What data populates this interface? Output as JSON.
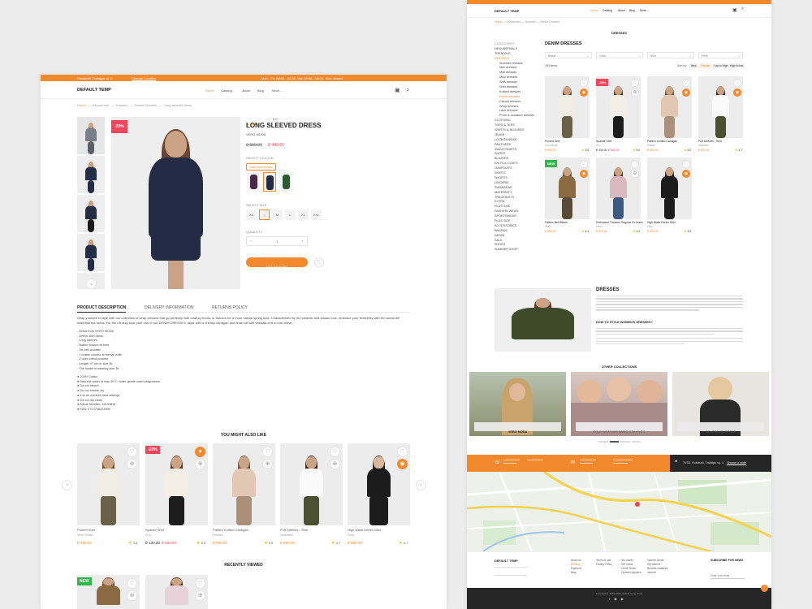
{
  "left": {
    "topbar": {
      "address": "Rustaveli, Trafalgar st. 4",
      "change_location": "Change Location",
      "phone": "Mon - Fri: 08:00 - 22:00",
      "hours": "Sat: 09:00 - 18:00",
      "sun": "Sun: closed"
    },
    "header": {
      "logo": "DEFAULT TEMP",
      "nav": [
        "Home",
        "Catalog",
        "About",
        "Blog",
        "More..."
      ]
    },
    "breadcrumb": [
      "Home",
      "Assortment",
      "Dresses",
      "Denim Dresses",
      "Long sleeved dress"
    ],
    "product": {
      "discount": "-20%",
      "rating": "5.0",
      "title": "LONG SLEEVED DRESS",
      "brand": "VERO MODA",
      "old_price": "₽ 550.00",
      "new_price": "₽ 440.00",
      "colour_label": "SELECT COLOUR",
      "colour_selected": "Dark blue flower",
      "size_label": "SELECT SIZE",
      "sizes": [
        "XS",
        "S",
        "M",
        "L",
        "XL",
        "XXL"
      ],
      "quantity_label": "QUANTITY",
      "quantity": "1",
      "add_to_cart": "ADD TO CART"
    },
    "tabs": [
      "PRODUCT DESCRIPTION",
      "DELIVERY INFORMATION",
      "RETURNS POLICY"
    ],
    "description": "Wrap yourself in style with our collection of wrap dresses that go perfectly with cowboy boots, or trainers for a more casual spring look. Characterised by its romantic and classic look, embrace your femininity with the wardrobe essential tea dress. For the off-duty look, pick one of our DENIM DRESSES, layer with a chunky cardigan and finish off with sandals and a cute clutch.",
    "features_1": [
      "Dress from VERO MODA",
      "Denim shirt dress",
      "Long sleeves",
      "Button closure at front",
      "Tie belt at waist",
      "1 button closure at sleeve cuffs",
      "2 open chest pockets",
      "Length: 97 cm in size 36",
      "The model is wearing size 36"
    ],
    "features_2": [
      "100% Cotton",
      "Machine wash at max 40°C under gentle wash programme",
      "Do not bleach",
      "Do not tumble dry",
      "Iron on medium heat settings",
      "Do not dry clean",
      "Article Number: 15133818",
      "EAN: 5713746323090"
    ],
    "related_title": "YOU MIGHT ALSO LIKE",
    "related": [
      {
        "name": "Printed Shirt",
        "brand": "Vero Moda",
        "price": "₽ 890.00",
        "old": "",
        "rating": "3.5",
        "badge": ""
      },
      {
        "name": "Sparkle Shirt",
        "brand": "G.G.",
        "price": "₽ 430.00",
        "old": "₽ 560.00",
        "rating": "5.0",
        "badge": "-20%"
      },
      {
        "name": "Pattern Knitted Cardigan",
        "brand": "Planes",
        "price": "₽ 890.00",
        "old": "",
        "rating": "5.0",
        "badge": ""
      },
      {
        "name": "Puff Sleeves - Shirt",
        "brand": "Selected",
        "price": "₽ 890.00",
        "old": "",
        "rating": "4.7",
        "badge": ""
      },
      {
        "name": "High Waist Denim Skirt",
        "brand": "Only",
        "price": "₽ 890.00",
        "old": "",
        "rating": "4.7",
        "badge": ""
      }
    ],
    "recent_title": "RECENTLY VIEWED",
    "recent_badge": "NEW"
  },
  "right": {
    "breadcrumb": [
      "Home",
      "Assortment",
      "Dresses",
      "Denim Dresses"
    ],
    "page_title": "DRESSES",
    "categories_title": "CATEGORIES",
    "categories": [
      "NEW ARRIVALS",
      "TRENDING",
      "DRESSES",
      "Summer dresses",
      "Mini dresses",
      "Midi dresses",
      "Maxi dresses",
      "Shift dresses",
      "Shirt dresses",
      "Knitted dresses",
      "Denim dresses",
      "Casual dresses",
      "Wrap dresses",
      "Lace dresses",
      "Prom & occasion dresses",
      "CLOTHING",
      "TOPS & TEES",
      "SHIRTS & BLOUSES",
      "JEANS",
      "LOUNGEWEAR",
      "PANTHERS",
      "SWEATSHIRTS",
      "SHOES",
      "BLAZERS",
      "KNITS & COATS",
      "JUMPSUITS",
      "SKIRTS",
      "SHORTS",
      "LINGERIE",
      "SWIMWEAR",
      "MATERNITY",
      "TRACKSUITS",
      "EXTRA",
      "PLUS SIZE",
      "FASHION WEAR",
      "SPORTSWEAR",
      "PLUS SIZE",
      "ACCESSORIES",
      "BRANDS",
      "DENIM",
      "SALE",
      "SHOES",
      "SUMMER SHOP"
    ],
    "list_title": "DENIM DRESSES",
    "filters": [
      "Brand",
      "Color",
      "Size",
      "Price"
    ],
    "count": "383 items",
    "sort_label": "Sort by:",
    "sort_options": [
      "New",
      "Popular",
      "Low to High",
      "High to low"
    ],
    "products": [
      {
        "name": "Printed Shirt",
        "brand": "Vero Moda",
        "price": "₽ 890.00",
        "old": "",
        "rating": "3.5",
        "badge": ""
      },
      {
        "name": "Sparkle Shirt",
        "brand": "G.G.",
        "price": "₽ 430.00",
        "old": "₽ 560.00",
        "rating": "5.0",
        "badge": "-20%"
      },
      {
        "name": "Pattern Knitted Cardigan",
        "brand": "Planes",
        "price": "₽ 890.00",
        "old": "",
        "rating": "5.0",
        "badge": ""
      },
      {
        "name": "Puff Sleeves - Shirt",
        "brand": "Selected",
        "price": "₽ 890.00",
        "old": "",
        "rating": "4.7",
        "badge": ""
      },
      {
        "name": "Pattern Belt Blazer",
        "brand": "Vila",
        "price": "₽ 890.00",
        "old": "",
        "rating": "4.4",
        "badge": "NEW"
      },
      {
        "name": "Embossed Trousers Regular Fit Jeans",
        "brand": "Levi's",
        "price": "₽ 890.00",
        "old": "",
        "rating": "4.9",
        "badge": ""
      },
      {
        "name": "High Waist Denim Skirt",
        "brand": "Only",
        "price": "₽ 890.00",
        "old": "",
        "rating": "4.9",
        "badge": ""
      }
    ],
    "seo_title": "DRESSES",
    "seo_sub": "HOW TO STYLE WOMEN'S DRESSES?",
    "collections_title": "OTHER COLLECTIONS",
    "collections": [
      "VERO MODA",
      "COLD WEATHER BASIC OTH KNITS",
      "GENERAL PURPOSE"
    ],
    "footer_logo": "DEFAULT TEMP",
    "newsletter_title": "SUBSCRIBE FOR NEWS",
    "newsletter_placeholder": "Enter your email",
    "map_address": "TVSD, Rustaveli, Trafalgar sq. 4",
    "map_link": "Choose a route",
    "footer_cols": [
      [
        "About us",
        "Delivery",
        "Payment",
        "Blog"
      ],
      [
        "Terms of use",
        "Privacy Policy"
      ],
      [
        "Our stores",
        "Gift Cards",
        "Credit Terms",
        "Ordered payment"
      ],
      [
        "Internet points",
        "Gift reserve",
        "Benefits materials",
        "Journal"
      ]
    ],
    "copyright": "Copyright © 2019-2024 Default Temp Store"
  }
}
